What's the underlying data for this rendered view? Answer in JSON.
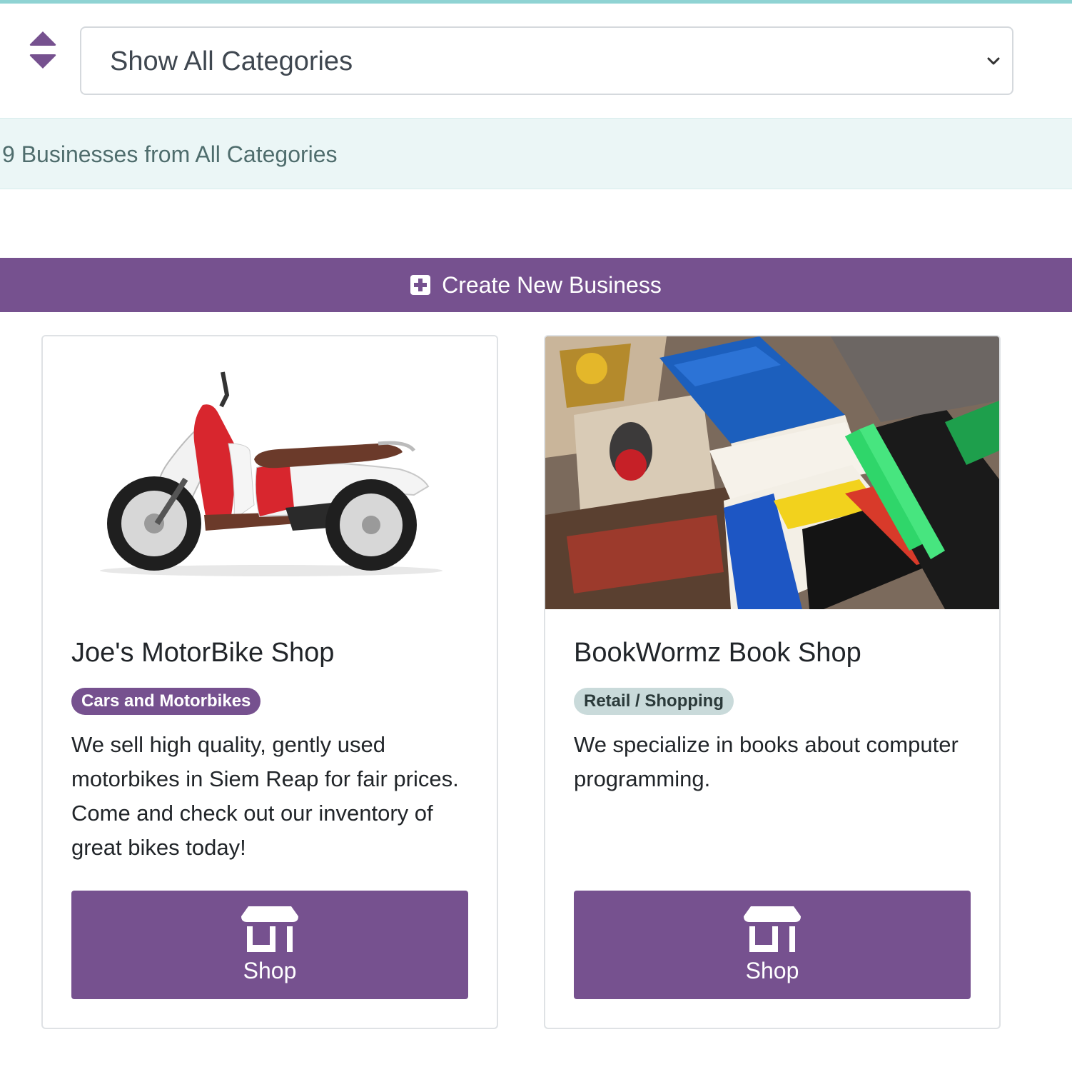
{
  "filter": {
    "selected": "Show All Categories",
    "sort_icon": "sort-up-down-icon",
    "chevron_icon": "chevron-down-icon"
  },
  "results": {
    "summary": "9 Businesses from All Categories"
  },
  "create": {
    "label": "Create New Business",
    "icon": "plus-square-icon"
  },
  "colors": {
    "accent": "#76518f",
    "top_bar": "#8fd3d3",
    "results_bg": "#ebf6f6",
    "badge_grey": "#c9dada"
  },
  "businesses": [
    {
      "name": "Joe's MotorBike Shop",
      "category": "Cars and Motorbikes",
      "description": "We sell high quality, gently used motorbikes in Siem Reap for fair prices. Come and check out our inventory of great bikes today!",
      "image": "motor-scooter-photo",
      "button_label": "Shop",
      "button_icon": "store-icon"
    },
    {
      "name": "BookWormz Book Shop",
      "category": "Retail / Shopping",
      "description": "We specialize in books about computer programming.",
      "image": "design-books-photo",
      "button_label": "Shop",
      "button_icon": "store-icon"
    }
  ]
}
